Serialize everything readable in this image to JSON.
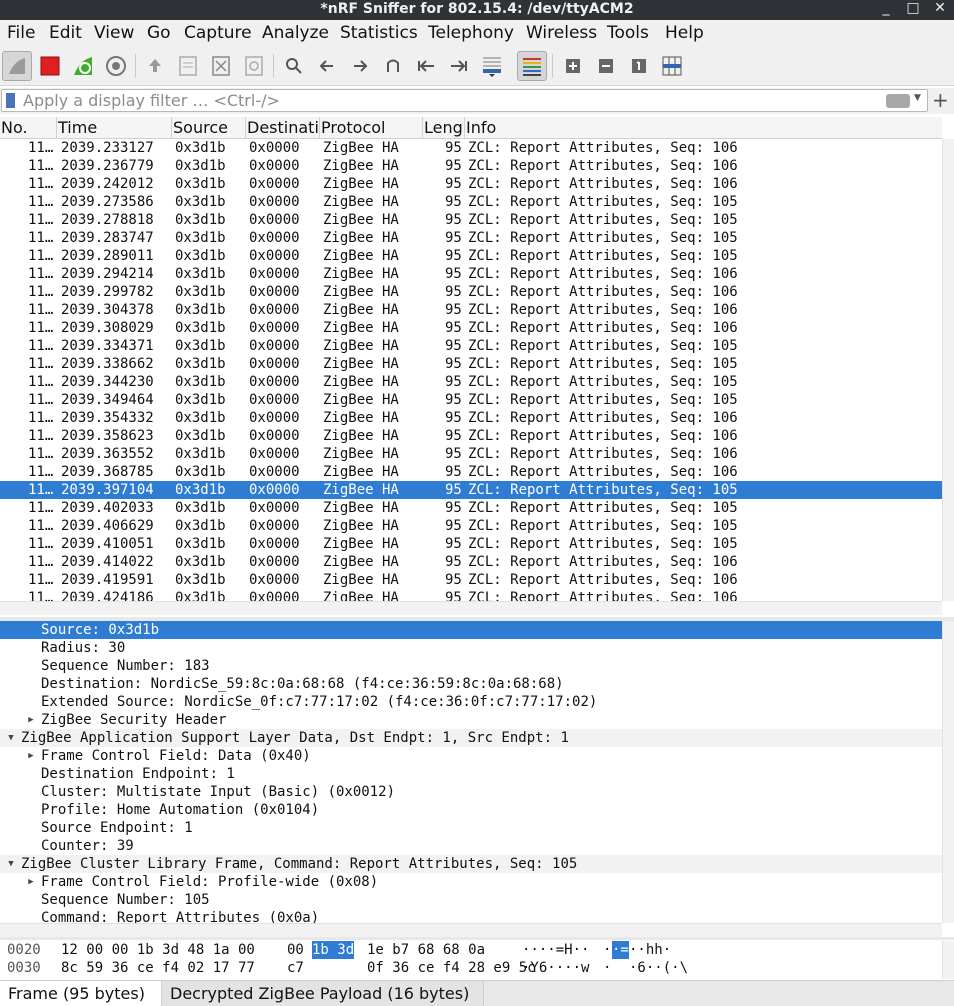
{
  "window": {
    "title": "*nRF Sniffer for 802.15.4: /dev/ttyACM2",
    "controls": [
      "_",
      "□",
      "✕"
    ]
  },
  "menu": [
    "File",
    "Edit",
    "View",
    "Go",
    "Capture",
    "Analyze",
    "Statistics",
    "Telephony",
    "Wireless",
    "Tools",
    "Help"
  ],
  "filter": {
    "placeholder": "Apply a display filter … <Ctrl-/>",
    "add_label": "+"
  },
  "packet_list": {
    "columns": [
      "No.",
      "Time",
      "Source",
      "Destinati",
      "Protocol",
      "Leng",
      "Info"
    ],
    "selected_index": 19,
    "rows": [
      {
        "no": "11…",
        "time": "2039.233127",
        "source": "0x3d1b",
        "destination": "0x0000",
        "protocol": "ZigBee HA",
        "length": "95",
        "info": "ZCL: Report Attributes, Seq: 106"
      },
      {
        "no": "11…",
        "time": "2039.236779",
        "source": "0x3d1b",
        "destination": "0x0000",
        "protocol": "ZigBee HA",
        "length": "95",
        "info": "ZCL: Report Attributes, Seq: 106"
      },
      {
        "no": "11…",
        "time": "2039.242012",
        "source": "0x3d1b",
        "destination": "0x0000",
        "protocol": "ZigBee HA",
        "length": "95",
        "info": "ZCL: Report Attributes, Seq: 106"
      },
      {
        "no": "11…",
        "time": "2039.273586",
        "source": "0x3d1b",
        "destination": "0x0000",
        "protocol": "ZigBee HA",
        "length": "95",
        "info": "ZCL: Report Attributes, Seq: 105"
      },
      {
        "no": "11…",
        "time": "2039.278818",
        "source": "0x3d1b",
        "destination": "0x0000",
        "protocol": "ZigBee HA",
        "length": "95",
        "info": "ZCL: Report Attributes, Seq: 105"
      },
      {
        "no": "11…",
        "time": "2039.283747",
        "source": "0x3d1b",
        "destination": "0x0000",
        "protocol": "ZigBee HA",
        "length": "95",
        "info": "ZCL: Report Attributes, Seq: 105"
      },
      {
        "no": "11…",
        "time": "2039.289011",
        "source": "0x3d1b",
        "destination": "0x0000",
        "protocol": "ZigBee HA",
        "length": "95",
        "info": "ZCL: Report Attributes, Seq: 105"
      },
      {
        "no": "11…",
        "time": "2039.294214",
        "source": "0x3d1b",
        "destination": "0x0000",
        "protocol": "ZigBee HA",
        "length": "95",
        "info": "ZCL: Report Attributes, Seq: 106"
      },
      {
        "no": "11…",
        "time": "2039.299782",
        "source": "0x3d1b",
        "destination": "0x0000",
        "protocol": "ZigBee HA",
        "length": "95",
        "info": "ZCL: Report Attributes, Seq: 106"
      },
      {
        "no": "11…",
        "time": "2039.304378",
        "source": "0x3d1b",
        "destination": "0x0000",
        "protocol": "ZigBee HA",
        "length": "95",
        "info": "ZCL: Report Attributes, Seq: 106"
      },
      {
        "no": "11…",
        "time": "2039.308029",
        "source": "0x3d1b",
        "destination": "0x0000",
        "protocol": "ZigBee HA",
        "length": "95",
        "info": "ZCL: Report Attributes, Seq: 106"
      },
      {
        "no": "11…",
        "time": "2039.334371",
        "source": "0x3d1b",
        "destination": "0x0000",
        "protocol": "ZigBee HA",
        "length": "95",
        "info": "ZCL: Report Attributes, Seq: 105"
      },
      {
        "no": "11…",
        "time": "2039.338662",
        "source": "0x3d1b",
        "destination": "0x0000",
        "protocol": "ZigBee HA",
        "length": "95",
        "info": "ZCL: Report Attributes, Seq: 105"
      },
      {
        "no": "11…",
        "time": "2039.344230",
        "source": "0x3d1b",
        "destination": "0x0000",
        "protocol": "ZigBee HA",
        "length": "95",
        "info": "ZCL: Report Attributes, Seq: 105"
      },
      {
        "no": "11…",
        "time": "2039.349464",
        "source": "0x3d1b",
        "destination": "0x0000",
        "protocol": "ZigBee HA",
        "length": "95",
        "info": "ZCL: Report Attributes, Seq: 105"
      },
      {
        "no": "11…",
        "time": "2039.354332",
        "source": "0x3d1b",
        "destination": "0x0000",
        "protocol": "ZigBee HA",
        "length": "95",
        "info": "ZCL: Report Attributes, Seq: 106"
      },
      {
        "no": "11…",
        "time": "2039.358623",
        "source": "0x3d1b",
        "destination": "0x0000",
        "protocol": "ZigBee HA",
        "length": "95",
        "info": "ZCL: Report Attributes, Seq: 106"
      },
      {
        "no": "11…",
        "time": "2039.363552",
        "source": "0x3d1b",
        "destination": "0x0000",
        "protocol": "ZigBee HA",
        "length": "95",
        "info": "ZCL: Report Attributes, Seq: 106"
      },
      {
        "no": "11…",
        "time": "2039.368785",
        "source": "0x3d1b",
        "destination": "0x0000",
        "protocol": "ZigBee HA",
        "length": "95",
        "info": "ZCL: Report Attributes, Seq: 106"
      },
      {
        "no": "11…",
        "time": "2039.397104",
        "source": "0x3d1b",
        "destination": "0x0000",
        "protocol": "ZigBee HA",
        "length": "95",
        "info": "ZCL: Report Attributes, Seq: 105"
      },
      {
        "no": "11…",
        "time": "2039.402033",
        "source": "0x3d1b",
        "destination": "0x0000",
        "protocol": "ZigBee HA",
        "length": "95",
        "info": "ZCL: Report Attributes, Seq: 105"
      },
      {
        "no": "11…",
        "time": "2039.406629",
        "source": "0x3d1b",
        "destination": "0x0000",
        "protocol": "ZigBee HA",
        "length": "95",
        "info": "ZCL: Report Attributes, Seq: 105"
      },
      {
        "no": "11…",
        "time": "2039.410051",
        "source": "0x3d1b",
        "destination": "0x0000",
        "protocol": "ZigBee HA",
        "length": "95",
        "info": "ZCL: Report Attributes, Seq: 105"
      },
      {
        "no": "11…",
        "time": "2039.414022",
        "source": "0x3d1b",
        "destination": "0x0000",
        "protocol": "ZigBee HA",
        "length": "95",
        "info": "ZCL: Report Attributes, Seq: 106"
      },
      {
        "no": "11…",
        "time": "2039.419591",
        "source": "0x3d1b",
        "destination": "0x0000",
        "protocol": "ZigBee HA",
        "length": "95",
        "info": "ZCL: Report Attributes, Seq: 106"
      },
      {
        "no": "11…",
        "time": "2039.424186",
        "source": "0x3d1b",
        "destination": "0x0000",
        "protocol": "ZigBee HA",
        "length": "95",
        "info": "ZCL: Report Attributes, Seq: 106"
      }
    ]
  },
  "details": {
    "lines": [
      {
        "text": "Source: 0x3d1b",
        "level": 2,
        "expander": "",
        "selected": true,
        "section": false
      },
      {
        "text": "Radius: 30",
        "level": 2,
        "expander": "",
        "selected": false,
        "section": false
      },
      {
        "text": "Sequence Number: 183",
        "level": 2,
        "expander": "",
        "selected": false,
        "section": false
      },
      {
        "text": "Destination: NordicSe_59:8c:0a:68:68 (f4:ce:36:59:8c:0a:68:68)",
        "level": 2,
        "expander": "",
        "selected": false,
        "section": false
      },
      {
        "text": "Extended Source: NordicSe_0f:c7:77:17:02 (f4:ce:36:0f:c7:77:17:02)",
        "level": 2,
        "expander": "",
        "selected": false,
        "section": false
      },
      {
        "text": "ZigBee Security Header",
        "level": 2,
        "expander": "▶",
        "selected": false,
        "section": false
      },
      {
        "text": "ZigBee Application Support Layer Data, Dst Endpt: 1, Src Endpt: 1",
        "level": 1,
        "expander": "▼",
        "selected": false,
        "section": true
      },
      {
        "text": "Frame Control Field: Data (0x40)",
        "level": 2,
        "expander": "▶",
        "selected": false,
        "section": false
      },
      {
        "text": "Destination Endpoint: 1",
        "level": 2,
        "expander": "",
        "selected": false,
        "section": false
      },
      {
        "text": "Cluster: Multistate Input (Basic) (0x0012)",
        "level": 2,
        "expander": "",
        "selected": false,
        "section": false
      },
      {
        "text": "Profile: Home Automation (0x0104)",
        "level": 2,
        "expander": "",
        "selected": false,
        "section": false
      },
      {
        "text": "Source Endpoint: 1",
        "level": 2,
        "expander": "",
        "selected": false,
        "section": false
      },
      {
        "text": "Counter: 39",
        "level": 2,
        "expander": "",
        "selected": false,
        "section": false
      },
      {
        "text": "ZigBee Cluster Library Frame, Command: Report Attributes, Seq: 105",
        "level": 1,
        "expander": "▼",
        "selected": false,
        "section": true
      },
      {
        "text": "Frame Control Field: Profile-wide (0x08)",
        "level": 2,
        "expander": "▶",
        "selected": false,
        "section": false
      },
      {
        "text": "Sequence Number: 105",
        "level": 2,
        "expander": "",
        "selected": false,
        "section": false
      },
      {
        "text": "Command: Report Attributes (0x0a)",
        "level": 2,
        "expander": "",
        "selected": false,
        "section": false
      }
    ]
  },
  "hex": {
    "lines": [
      {
        "offset": "0020",
        "bytes_a": "12 00 00 1b 3d 48 1a 00",
        "bytes_b_pre": "00",
        "bytes_b_hl": "1b 3d",
        "bytes_b_post": "1e b7 68 68 0a",
        "ascii_a": "····=H··",
        "ascii_b_pre": "·",
        "ascii_b_hl": "·=",
        "ascii_b_post": "··hh·"
      },
      {
        "offset": "0030",
        "bytes_a": "8c 59 36 ce f4 02 17 77",
        "bytes_b_pre": "c7",
        "bytes_b_hl": "",
        "bytes_b_post": "0f 36 ce f4 28 e9 5c",
        "ascii_a": "·Y6····w",
        "ascii_b_pre": "·",
        "ascii_b_hl": "",
        "ascii_b_post": "·6··(·\\"
      }
    ]
  },
  "tabs": [
    {
      "label": "Frame (95 bytes)",
      "active": true
    },
    {
      "label": "Decrypted ZigBee Payload (16 bytes)",
      "active": false
    }
  ],
  "colors": {
    "selection": "#2f7cd3",
    "titlebar": "#2f3236",
    "stop_button": "#e02020",
    "restart_button": "#3fae2a"
  }
}
